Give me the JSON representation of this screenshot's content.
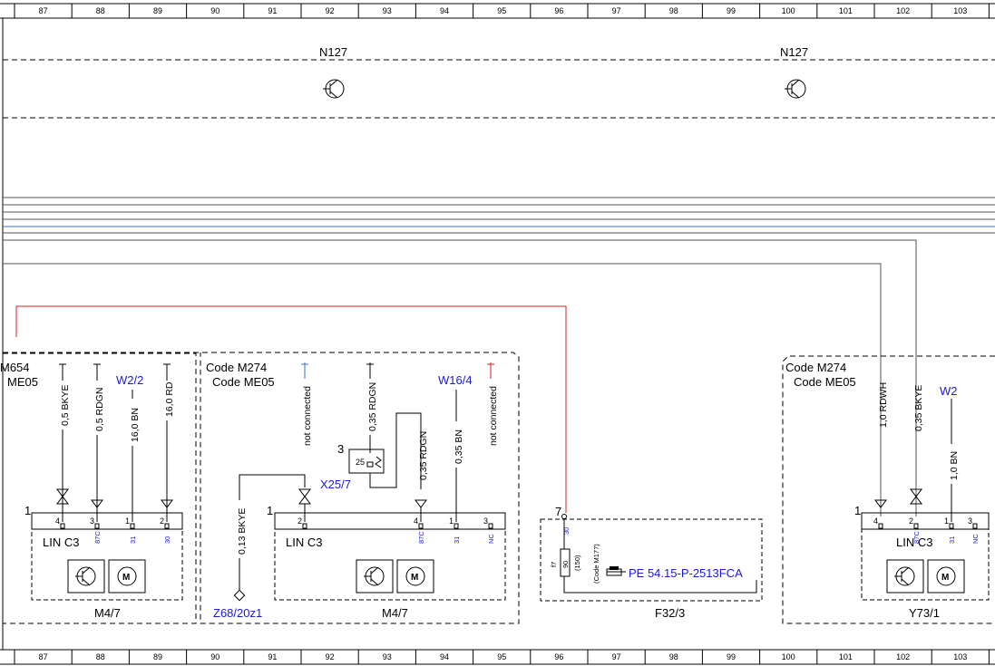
{
  "ruler_numbers": [
    "87",
    "88",
    "89",
    "90",
    "91",
    "92",
    "93",
    "94",
    "95",
    "96",
    "97",
    "98",
    "99",
    "100",
    "101",
    "102",
    "103"
  ],
  "n127": [
    "N127",
    "N127"
  ],
  "left_block": {
    "code1": "M654",
    "code2": "ME05",
    "wires": [
      "0,5 BKYE",
      "0,5 RDGN",
      "16,0 BN",
      "16,0 RD"
    ],
    "w22": "W2/2",
    "pins": [
      "4",
      "3",
      "1",
      "2"
    ],
    "pin_funcs": [
      "87C",
      "31",
      "30"
    ],
    "side_pin": "1",
    "lin": "LIN C3",
    "name": "M4/7"
  },
  "mid_block": {
    "code1": "Code M274",
    "code2": "Code ME05",
    "not_connected": "not connected",
    "wires": [
      "0,35 RDGN",
      "0,35 RDGN",
      "0,35 BN"
    ],
    "w164": "W16/4",
    "conn_pin": "3",
    "conn_num": "25",
    "x25": "X25/7",
    "bkye": "0,13 BKYE",
    "z68": "Z68/20z1",
    "side_pin": "1",
    "pins": [
      "2",
      "4",
      "1",
      "3"
    ],
    "pin_funcs": [
      "87C",
      "31",
      "NC"
    ],
    "lin": "LIN C3",
    "name": "M4/7"
  },
  "fuse_block": {
    "pin": "7",
    "pin_func": "30",
    "fuse_num": "f7",
    "fuse_rating": "90",
    "fuse_extra": "(150)",
    "code": "(Code M177)",
    "pe_ref": "PE 54.15-P-2513FCA",
    "name": "F32/3"
  },
  "right_block": {
    "code1": "Code M274",
    "code2": "Code ME05",
    "wires": [
      "1,0 RDWH",
      "0,35 BKYE",
      "1,0 BN"
    ],
    "w2": "W2",
    "side_pin": "1",
    "pins": [
      "4",
      "2",
      "1",
      "3"
    ],
    "pin_funcs": [
      "87C",
      "31",
      "NC"
    ],
    "lin": "LIN C3",
    "name": "Y73/1"
  },
  "colors": {
    "blue_text": "#1a1ad4",
    "red_wire": "#d42020",
    "blue_bus": "#3a6fd8"
  }
}
